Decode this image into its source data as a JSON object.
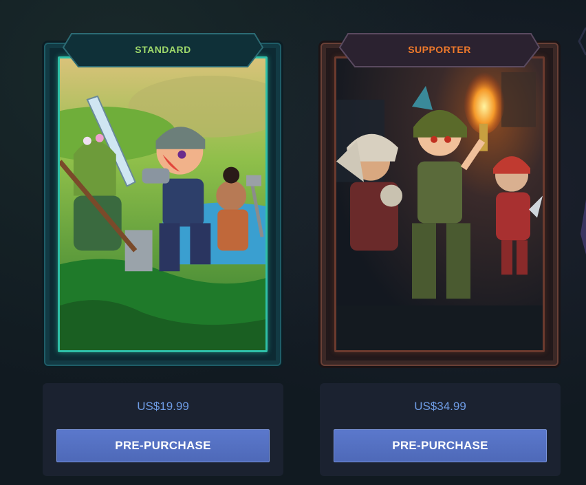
{
  "editions": [
    {
      "name": "STANDARD",
      "price": "US$19.99",
      "button_label": "PRE-PURCHASE"
    },
    {
      "name": "SUPPORTER",
      "price": "US$34.99",
      "button_label": "PRE-PURCHASE"
    }
  ],
  "colors": {
    "background": "#111a21",
    "standard_title": "#9fd96b",
    "supporter_title": "#f07a2b",
    "price_text": "#6f9de6",
    "button": "#5570c0",
    "panel": "#1b2230"
  }
}
